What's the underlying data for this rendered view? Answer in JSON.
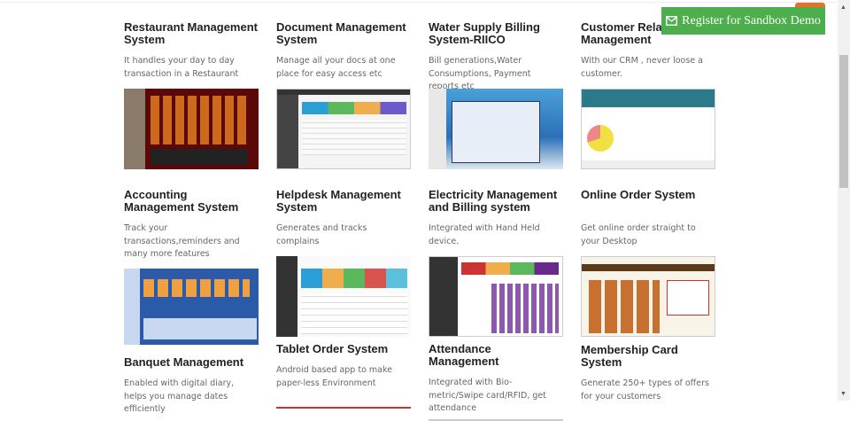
{
  "register_button": {
    "label": "Register for Sandbox Demo",
    "icon": "envelope-icon",
    "color": "#4cae4c"
  },
  "products": [
    {
      "title": "Restaurant Management System",
      "desc": "It handles your day to day transaction in a Restaurant"
    },
    {
      "title": "Document Management System",
      "desc": "Manage all your docs at one place for easy access etc"
    },
    {
      "title": "Water Supply Billing System-RIICO",
      "desc": "Bill generations,Water Consumptions, Payment reports etc"
    },
    {
      "title": "Customer Relationship Management",
      "desc": "With our CRM , never loose a customer."
    },
    {
      "title": "Accounting Management System",
      "desc": "Track your transactions,reminders and many more features"
    },
    {
      "title": "Helpdesk Management System",
      "desc": "Generates and tracks complains"
    },
    {
      "title": "Electricity Management and Billing system",
      "desc": "Integrated with Hand Held device."
    },
    {
      "title": "Online Order System",
      "desc": "Get online order straight to your Desktop"
    },
    {
      "title": "Banquet Management",
      "desc": "Enabled with digital diary, helps you manage dates efficiently"
    },
    {
      "title": "Tablet Order System",
      "desc": "Android based app to make paper-less Environment"
    },
    {
      "title": "Attendance Management",
      "desc": "Integrated with Bio-metric/Swipe card/RFID, get attendance"
    },
    {
      "title": "Membership Card System",
      "desc": "Generate 250+ types of offers for your customers"
    }
  ]
}
